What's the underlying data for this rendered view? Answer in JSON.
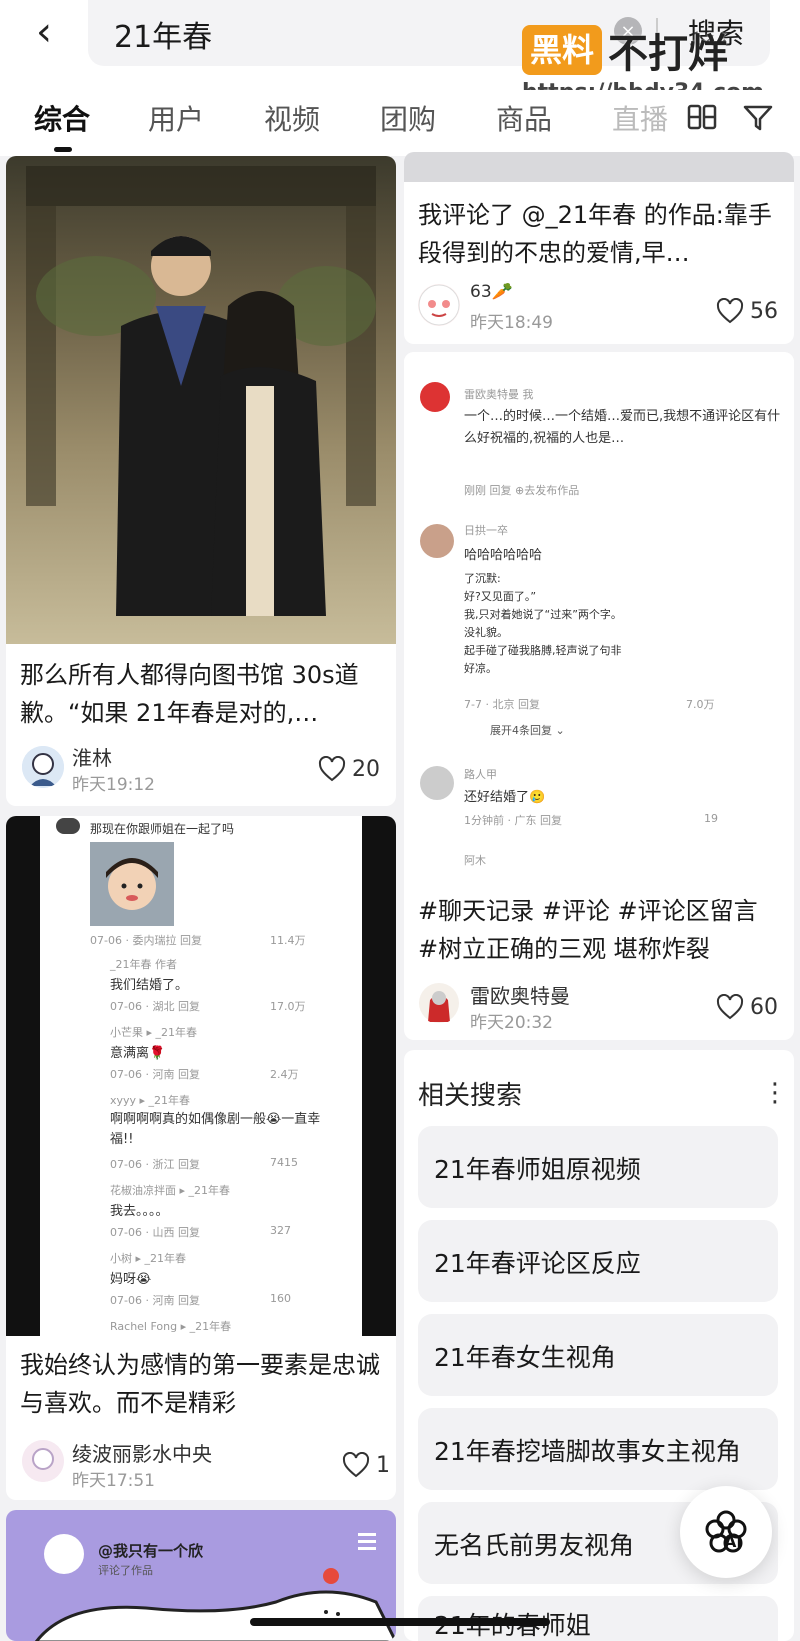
{
  "search": {
    "query": "21年春",
    "button": "搜索",
    "clear": "×",
    "back": "‹"
  },
  "watermark": {
    "badge": "黑料",
    "text": "不打烊",
    "url": "https://bbdy34.com"
  },
  "tabs": [
    "综合",
    "用户",
    "视频",
    "团购",
    "商品",
    "直播"
  ],
  "left_cards": [
    {
      "title": "那么所有人都得向图书馆 30s道歉。“如果 21年春是对的,…",
      "author": "淮林",
      "time": "昨天19:12",
      "likes": "20"
    },
    {
      "title": "我始终认为感情的第一要素是忠诚与喜欢。而不是精彩",
      "author": "绫波丽影水中央",
      "time": "昨天17:51",
      "likes": "1"
    }
  ],
  "left_card2_shot": {
    "header": "那现在你跟师姐在一起了吗",
    "rows": [
      {
        "name": "",
        "text": "",
        "meta": "07-06 · 委内瑞拉    回复",
        "likes": "11.4万"
      },
      {
        "name": "_21年春  作者",
        "text": "我们结婚了。",
        "meta": "07-06 · 湖北    回复",
        "likes": "17.0万"
      },
      {
        "name": "小芒果 ▸ _21年春",
        "text": "意满离🌹",
        "meta": "07-06 · 河南    回复",
        "likes": "2.4万"
      },
      {
        "name": "xyyy ▸ _21年春",
        "text": "啊啊啊啊真的如偶像剧一般😭一直幸福!!",
        "meta": "07-06 · 浙江    回复",
        "likes": "7415"
      },
      {
        "name": "花椒油凉拌面 ▸ _21年春",
        "text": "我去。。。。",
        "meta": "07-06 · 山西    回复",
        "likes": "327"
      },
      {
        "name": "小树 ▸ _21年春",
        "text": "妈呀😭",
        "meta": "07-06 · 河南    回复",
        "likes": "160"
      },
      {
        "name": "Rachel Fong ▸ _21年春",
        "text": "",
        "meta": "",
        "likes": ""
      }
    ]
  },
  "left_card3": {
    "author": "@我只有一个欣",
    "sub": "评论了作品"
  },
  "right_card1": {
    "title": "我评论了 @_21年春 的作品:靠手段得到的不忠的爱情,早…",
    "author": "63🥕",
    "time": "昨天18:49",
    "likes": "56"
  },
  "right_card2_shot": {
    "c1_name": "雷欧奥特曼  我",
    "c1_text": "一个…的时候…一个结婚…爱而已,我想不通评论区有什么好祝福的,祝福的人也是…",
    "c1_meta": "刚刚    回复    ⊕去发布作品",
    "c2_name": "日拱一卒",
    "c2_text": "哈哈哈哈哈哈",
    "c2_quote": "了沉默:\n好?又见面了。”\n我,只对着她说了“过来”两个字。\n没礼貌。\n起手碰了碰我胳膊,轻声说了句非\n好凉。",
    "c2_meta": "7-7 · 北京    回复",
    "c2_likes": "7.0万",
    "c2_expand": "展开4条回复 ⌄",
    "c3_name": "路人甲",
    "c3_text": "还好结婚了🥲",
    "c3_meta": "1分钟前 · 广东    回复",
    "c3_likes": "19",
    "c4_name": "阿木"
  },
  "right_card2": {
    "title": "#聊天记录 #评论 #评论区留言 #树立正确的三观 堪称炸裂",
    "author": "雷欧奥特曼",
    "time": "昨天20:32",
    "likes": "60"
  },
  "related": {
    "title": "相关搜索",
    "more": "⋮",
    "items": [
      "21年春师姐原视频",
      "21年春评论区反应",
      "21年春女生视角",
      "21年春挖墙脚故事女主视角",
      "无名氏前男友视角",
      "21年的春师姐"
    ]
  },
  "ai_button": "AI"
}
